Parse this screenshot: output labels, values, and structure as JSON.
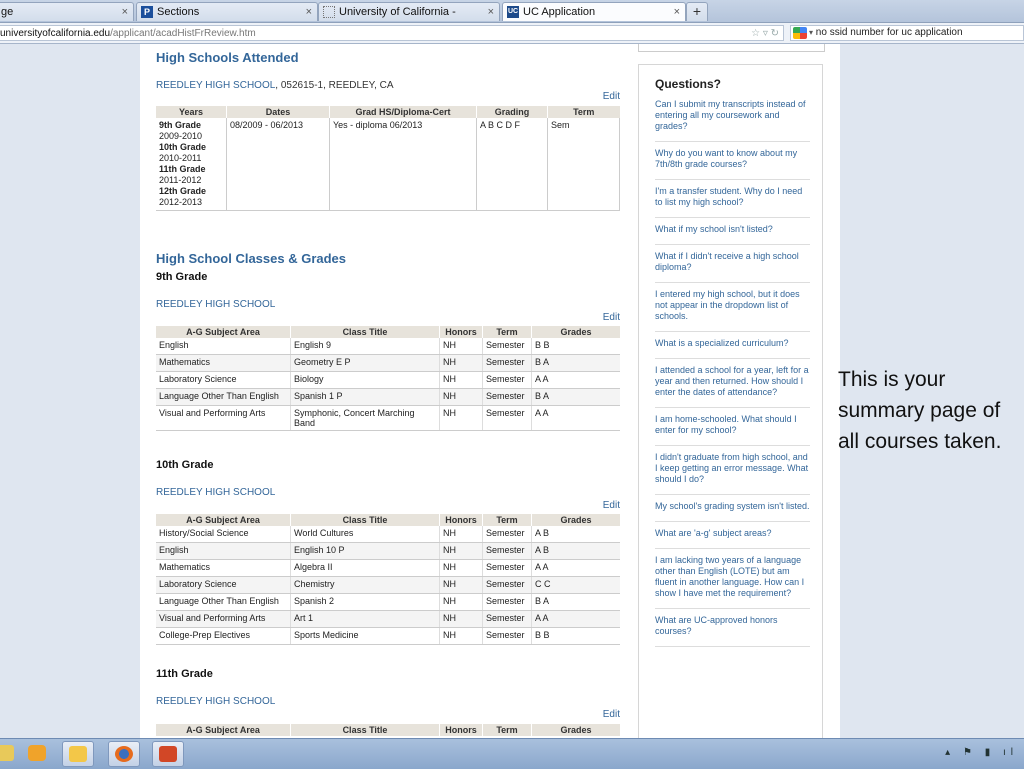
{
  "browser": {
    "tabs": [
      {
        "label": "ge",
        "close": "×"
      },
      {
        "label": "Sections",
        "close": "×"
      },
      {
        "label": "University of California -",
        "close": "×"
      },
      {
        "label": "UC Application",
        "close": "×"
      }
    ],
    "new_tab": "+",
    "url_host": "universityofcalifornia.edu",
    "url_path": "/applicant/acadHistFrReview.htm",
    "search_text": "no ssid number for uc application"
  },
  "hs_attended": {
    "title": "High Schools Attended",
    "school_name": "REEDLEY HIGH SCHOOL",
    "school_rest": ", 052615-1, REEDLEY, CA",
    "edit": "Edit",
    "headers": [
      "Years",
      "Dates",
      "Grad HS/Diploma-Cert",
      "Grading",
      "Term"
    ],
    "years": [
      {
        "grade": "9th Grade",
        "span": "2009-2010"
      },
      {
        "grade": "10th Grade",
        "span": "2010-2011"
      },
      {
        "grade": "11th Grade",
        "span": "2011-2012"
      },
      {
        "grade": "12th Grade",
        "span": "2012-2013"
      }
    ],
    "dates": "08/2009 - 06/2013",
    "grad": "Yes - diploma 06/2013",
    "grading": "A B C D F",
    "term": "Sem"
  },
  "classes": {
    "title": "High School Classes & Grades",
    "headers": [
      "A-G Subject Area",
      "Class Title",
      "Honors",
      "Term",
      "Grades"
    ],
    "grade9": {
      "label": "9th Grade",
      "school": "REEDLEY HIGH SCHOOL",
      "edit": "Edit",
      "rows": [
        [
          "English",
          "English 9",
          "NH",
          "Semester",
          "B B"
        ],
        [
          "Mathematics",
          "Geometry E P",
          "NH",
          "Semester",
          "B A"
        ],
        [
          "Laboratory Science",
          "Biology",
          "NH",
          "Semester",
          "A A"
        ],
        [
          "Language Other Than English",
          "Spanish 1 P",
          "NH",
          "Semester",
          "B A"
        ],
        [
          "Visual and Performing Arts",
          "Symphonic, Concert Marching Band",
          "NH",
          "Semester",
          "A A"
        ]
      ]
    },
    "grade10": {
      "label": "10th Grade",
      "school": "REEDLEY HIGH SCHOOL",
      "edit": "Edit",
      "rows": [
        [
          "History/Social Science",
          "World Cultures",
          "NH",
          "Semester",
          "A B"
        ],
        [
          "English",
          "English 10 P",
          "NH",
          "Semester",
          "A B"
        ],
        [
          "Mathematics",
          "Algebra II",
          "NH",
          "Semester",
          "A A"
        ],
        [
          "Laboratory Science",
          "Chemistry",
          "NH",
          "Semester",
          "C C"
        ],
        [
          "Language Other Than English",
          "Spanish 2",
          "NH",
          "Semester",
          "B A"
        ],
        [
          "Visual and Performing Arts",
          "Art 1",
          "NH",
          "Semester",
          "A A"
        ],
        [
          "College-Prep Electives",
          "Sports Medicine",
          "NH",
          "Semester",
          "B B"
        ]
      ]
    },
    "grade11": {
      "label": "11th Grade",
      "school": "REEDLEY HIGH SCHOOL",
      "edit": "Edit"
    }
  },
  "sidebar": {
    "title": "Questions?",
    "questions": [
      "Can I submit my transcripts instead of entering all my coursework and grades?",
      "Why do you want to know about my 7th/8th grade courses?",
      "I'm a transfer student. Why do I need to list my high school?",
      "What if my school isn't listed?",
      "What if I didn't receive a high school diploma?",
      "I entered my high school, but it does not appear in the dropdown list of schools.",
      "What is a specialized curriculum?",
      "I attended a school for a year, left for a year and then returned. How should I enter the dates of attendance?",
      "I am home-schooled. What should I enter for my school?",
      "I didn't graduate from high school, and I keep getting an error message. What should I do?",
      "My school's grading system isn't listed.",
      "What are 'a-g' subject areas?",
      "I am lacking two years of a language other than English (LOTE) but am fluent in another language. How can I show I have met the requirement?",
      "What are UC-approved honors courses?"
    ]
  },
  "annotation": "This is your summary page of all courses taken.",
  "colors": {
    "link": "#336699",
    "header_bg": "#e7e3db",
    "taskbar": "#8aa7cc"
  }
}
